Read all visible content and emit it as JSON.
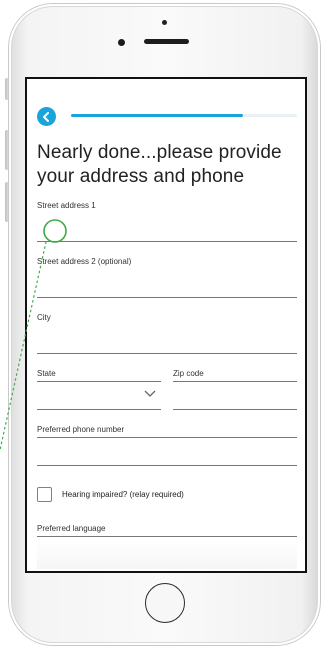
{
  "header": {
    "back_icon": "chevron-left-icon",
    "progress": 0.76
  },
  "page": {
    "title": "Nearly done...please provide your address and phone"
  },
  "form": {
    "street1_label": "Street address 1",
    "street2_label": "Street address 2 (optional)",
    "city_label": "City",
    "state_label": "State",
    "zip_label": "Zip code",
    "phone_label": "Preferred phone number",
    "hearing_label": "Hearing impaired? (relay required)",
    "language_label": "Preferred language"
  },
  "colors": {
    "accent": "#1aa4dc",
    "touch_indicator": "#3fa84a"
  }
}
